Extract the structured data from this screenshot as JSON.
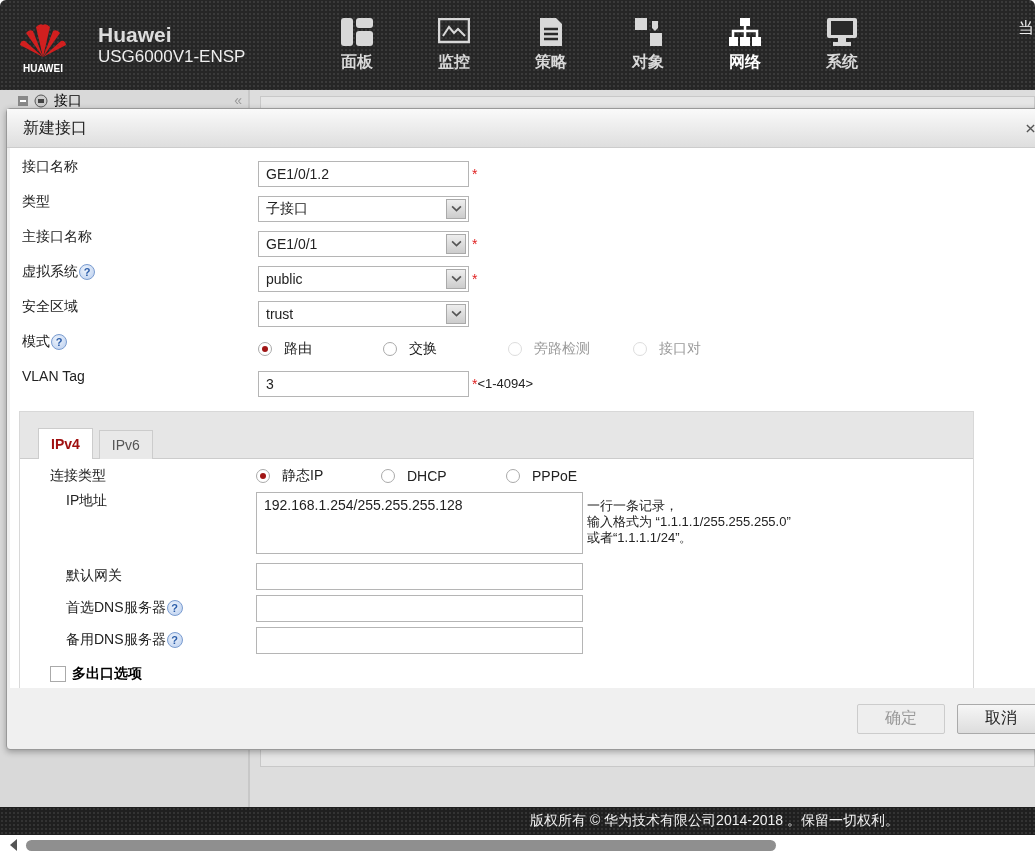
{
  "header": {
    "brand": "HUAWEI",
    "product": "Huawei",
    "model": "USG6000V1-ENSP",
    "nav": [
      {
        "label": "面板",
        "selected": false
      },
      {
        "label": "监控",
        "selected": false
      },
      {
        "label": "策略",
        "selected": false
      },
      {
        "label": "对象",
        "selected": false
      },
      {
        "label": "网络",
        "selected": true
      },
      {
        "label": "系统",
        "selected": false
      }
    ],
    "corner_text": "当"
  },
  "sidebar": {
    "items": [
      {
        "label": "接口",
        "expanded": true
      }
    ],
    "collapse": "«"
  },
  "dialog": {
    "title": "新建接口",
    "fields": [
      {
        "kind": "text",
        "label": "接口名称",
        "value": "GE1/0/1.2",
        "required_mark": "*"
      },
      {
        "kind": "select",
        "label": "类型",
        "value": "子接口"
      },
      {
        "kind": "select",
        "label": "主接口名称",
        "value": "GE1/0/1",
        "required_mark": "*"
      },
      {
        "kind": "select",
        "label": "虚拟系统",
        "value": "public",
        "required_mark": "*",
        "help": "?"
      },
      {
        "kind": "select",
        "label": "安全区域",
        "value": "trust"
      },
      {
        "kind": "radio",
        "label": "模式",
        "help": "?",
        "options": [
          {
            "label": "路由",
            "selected": true,
            "disabled": false
          },
          {
            "label": "交换",
            "selected": false,
            "disabled": false
          },
          {
            "label": "旁路检测",
            "selected": false,
            "disabled": true
          },
          {
            "label": "接口对",
            "selected": false,
            "disabled": true
          }
        ]
      },
      {
        "kind": "text",
        "label": "VLAN Tag",
        "value": "3",
        "required_mark": "*",
        "hint": "<1-4094>"
      }
    ],
    "tabs": [
      {
        "label": "IPv4",
        "selected": true
      },
      {
        "label": "IPv6",
        "selected": false
      }
    ],
    "connection": {
      "label": "连接类型",
      "options": [
        {
          "label": "静态IP",
          "selected": true
        },
        {
          "label": "DHCP",
          "selected": false
        },
        {
          "label": "PPPoE",
          "selected": false
        }
      ]
    },
    "ip": {
      "label": "IP地址",
      "value": "192.168.1.254/255.255.255.128",
      "notes": [
        "一行一条记录，",
        "输入格式为 “1.1.1.1/255.255.255.0”",
        "或者“1.1.1.1/24”。"
      ]
    },
    "ip_fields": [
      {
        "label": "默认网关"
      },
      {
        "label": "首选DNS服务器",
        "help": "?"
      },
      {
        "label": "备用DNS服务器",
        "help": "?"
      }
    ],
    "multi_exit": {
      "label": "多出口选项",
      "checked": false
    },
    "buttons": [
      {
        "label": "确定",
        "disabled": true
      },
      {
        "label": "取消",
        "disabled": false
      }
    ]
  },
  "footer": {
    "copyright": "版权所有 © 华为技术有限公司2014-2018 。保留一切权利。"
  }
}
